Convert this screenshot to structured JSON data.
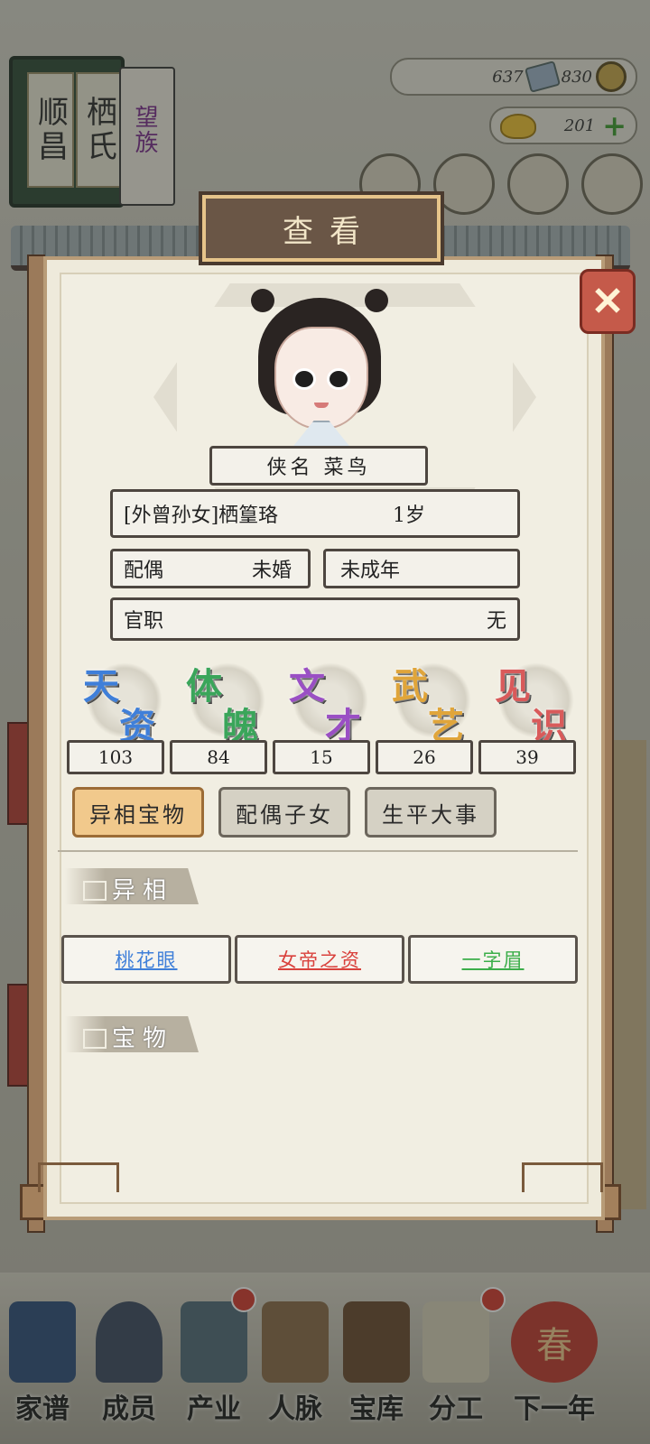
{
  "family": {
    "name_chars": [
      "顺昌",
      "栖氏"
    ],
    "tag": "望族"
  },
  "resources": {
    "silver": "637",
    "copper": "830",
    "gold": "201"
  },
  "bottom_nav": [
    {
      "label": "家谱"
    },
    {
      "label": "成员"
    },
    {
      "label": "产业"
    },
    {
      "label": "人脉"
    },
    {
      "label": "宝库"
    },
    {
      "label": "分工"
    },
    {
      "label": "下一年"
    }
  ],
  "next_year_badge": "春",
  "modal": {
    "title": "查看",
    "close_label": "✕",
    "nickname": "侠名 菜鸟",
    "relation": "[外曾孙女]栖篁珞",
    "age": "1岁",
    "spouse_label": "配偶",
    "spouse_value": "未婚",
    "adult_status": "未成年",
    "office_label": "官职",
    "office_value": "无",
    "stats": [
      {
        "chars": [
          "天",
          "资"
        ],
        "value": "103",
        "color": "#3f7fd9"
      },
      {
        "chars": [
          "体",
          "魄"
        ],
        "value": "84",
        "color": "#3aa55a"
      },
      {
        "chars": [
          "文",
          "才"
        ],
        "value": "15",
        "color": "#9a4fc4"
      },
      {
        "chars": [
          "武",
          "艺"
        ],
        "value": "26",
        "color": "#e0a53a"
      },
      {
        "chars": [
          "见",
          "识"
        ],
        "value": "39",
        "color": "#d95a5a"
      }
    ],
    "tabs": [
      {
        "label": "异相宝物",
        "active": true
      },
      {
        "label": "配偶子女",
        "active": false
      },
      {
        "label": "生平大事",
        "active": false
      }
    ],
    "section_traits": "异相",
    "traits": [
      {
        "label": "桃花眼",
        "color": "#3f7fd9"
      },
      {
        "label": "女帝之资",
        "color": "#d9413c"
      },
      {
        "label": "一字眉",
        "color": "#3cae4a"
      }
    ],
    "section_treasures": "宝物"
  }
}
